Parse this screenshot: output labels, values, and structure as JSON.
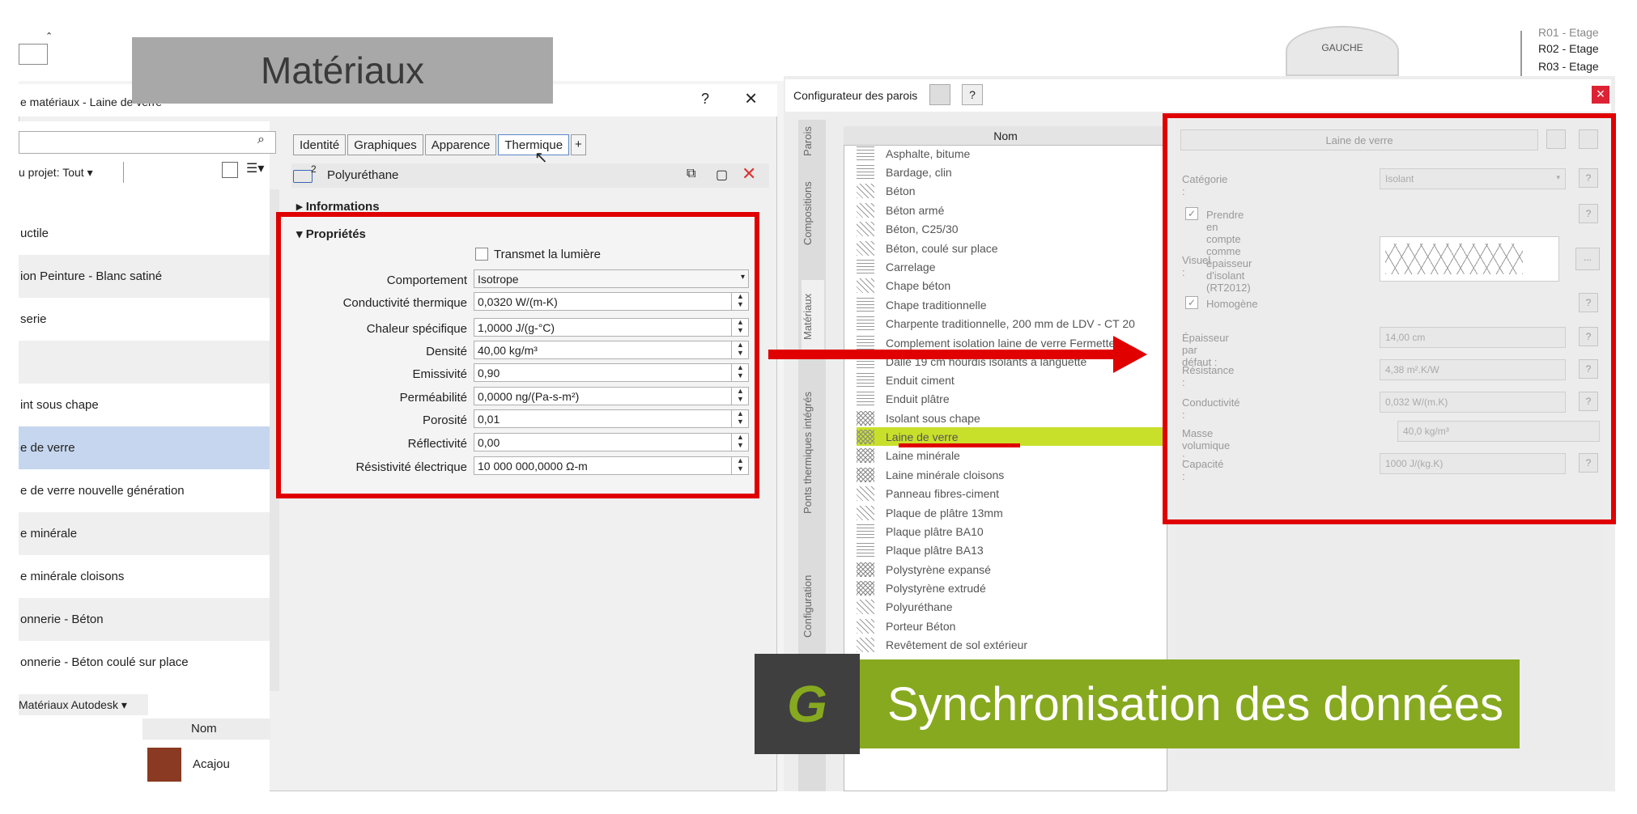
{
  "banner_title": "Matériaux",
  "materials_dialog": {
    "title": "e matériaux - Laine de verre",
    "help": "?",
    "close": "×",
    "filter_label": "u projet: Tout",
    "list": [
      "uctile",
      "ion Peinture - Blanc satiné",
      "serie",
      "",
      "int sous chape",
      "e de verre",
      "e de verre nouvelle génération",
      "e minérale",
      "e minérale cloisons",
      "onnerie - Béton",
      "onnerie - Béton coulé sur place"
    ],
    "selected_index": 5,
    "autodesk_filter": "Matériaux Autodesk",
    "library_col": "Nom",
    "library_item": "Acajou",
    "tabs": [
      "Identité",
      "Graphiques",
      "Apparence",
      "Thermique",
      "+"
    ],
    "active_tab": "Thermique",
    "asset_name": "Polyuréthane",
    "asset_num": "2",
    "section_info": "Informations",
    "section_props": "Propriétés",
    "transmit_light": "Transmet la lumière",
    "fields": [
      {
        "label": "Comportement",
        "value": "Isotrope"
      },
      {
        "label": "Conductivité thermique",
        "value": "0,0320 W/(m-K)"
      },
      {
        "label": "Chaleur spécifique",
        "value": "1,0000 J/(g-°C)"
      },
      {
        "label": "Densité",
        "value": "40,00 kg/m³"
      },
      {
        "label": "Emissivité",
        "value": "0,90"
      },
      {
        "label": "Perméabilité",
        "value": "0,0000 ng/(Pa-s-m²)"
      },
      {
        "label": "Porosité",
        "value": "0,01"
      },
      {
        "label": "Réflectivité",
        "value": "0,00"
      },
      {
        "label": "Résistivité électrique",
        "value": "10 000 000,0000 Ω-m"
      }
    ]
  },
  "configurator": {
    "title": "Configurateur des parois",
    "help": "?",
    "close": "×",
    "vtabs": [
      "Parois",
      "Compositions",
      "Matériaux",
      "Ponts thermiques intégrés",
      "Configuration"
    ],
    "column": "Nom",
    "items": [
      "Asphalte, bitume",
      "Bardage, clin",
      "Béton",
      "Béton armé",
      "Béton, C25/30",
      "Béton, coulé sur place",
      "Carrelage",
      "Chape béton",
      "Chape traditionnelle",
      "Charpente traditionnelle, 200 mm de LDV - CT 20",
      "Complement isolation laine de verre Fermette",
      "Dalle 19 cm hourdis isolants à languette",
      "Enduit ciment",
      "Enduit plâtre",
      "Isolant sous chape",
      "Laine de verre",
      "Laine minérale",
      "Laine minérale cloisons",
      "Panneau fibres-ciment",
      "Plaque de plâtre 13mm",
      "Plaque plâtre BA10",
      "Plaque plâtre BA13",
      "Polystyrène expansé",
      "Polystyrène extrudé",
      "Polyuréthane",
      "Porteur Béton",
      "Revêtement de sol extérieur"
    ],
    "selected_index": 15,
    "props": {
      "name": "Laine de verre",
      "category_label": "Catégorie :",
      "category_value": "Isolant",
      "rt2012_label": "Prendre en compte comme épaisseur d'isolant (RT2012)",
      "visual_label": "Visuel :",
      "visual_btn": "...",
      "homogene_label": "Homogène",
      "thickness_label": "Épaisseur par défaut :",
      "thickness_value": "14,00 cm",
      "resistance_label": "Résistance :",
      "resistance_value": "4,38 m².K/W",
      "conductivity_label": "Conductivité :",
      "conductivity_value": "0,032 W/(m.K)",
      "density_label": "Masse volumique :",
      "density_value": "40,0 kg/m³",
      "capacity_label": "Capacité :",
      "capacity_value": "1000 J/(kg.K)",
      "q": "?"
    }
  },
  "nav_cube_label": "GAUCHE",
  "levels": [
    "R01 - Etage",
    "R02 - Etage",
    "R03 - Etage"
  ],
  "sync_banner": "Synchronisation des données",
  "sync_logo": "G",
  "colors": {
    "highlight_red": "#e00000",
    "brand_green": "#87a91f",
    "selection_lime": "#c8e02a"
  }
}
